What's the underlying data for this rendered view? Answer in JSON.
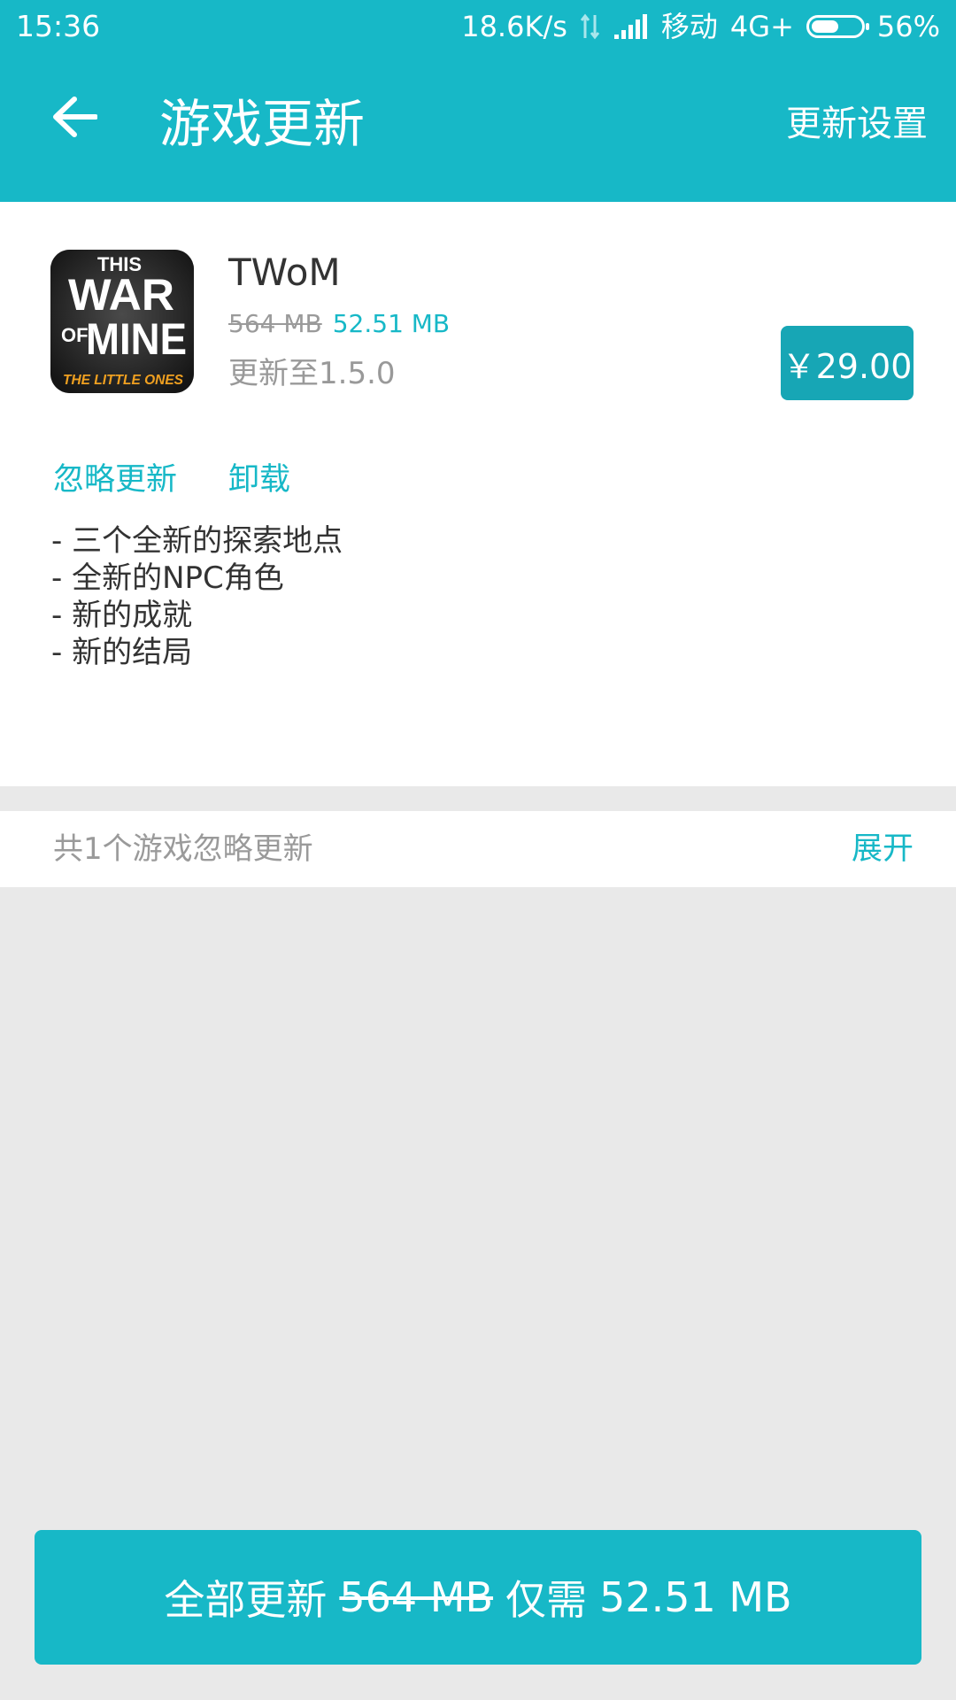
{
  "status_bar": {
    "time": "15:36",
    "network_speed": "18.6K/s",
    "carrier": "移动",
    "network_type": "4G+",
    "battery_percent": "56%",
    "battery_level": 0.56,
    "icons": [
      "data-arrows-icon",
      "signal-icon",
      "battery-icon"
    ]
  },
  "header": {
    "title": "游戏更新",
    "settings_label": "更新设置",
    "back_icon": "back-arrow-icon"
  },
  "game": {
    "name": "TWoM",
    "old_size": "564 MB",
    "new_size": "52.51 MB",
    "version_text": "更新至1.5.0",
    "price": "￥29.00",
    "icon_lines": [
      "THIS",
      "WAR",
      "OF",
      "MINE",
      "THE LITTLE ONES"
    ],
    "actions": {
      "ignore": "忽略更新",
      "uninstall": "卸载"
    },
    "changelog": [
      "- 三个全新的探索地点",
      "- 全新的NPC角色",
      "- 新的成就",
      "- 新的结局"
    ]
  },
  "ignored": {
    "text": "共1个游戏忽略更新",
    "expand_label": "展开"
  },
  "bottom_button": {
    "prefix": "全部更新",
    "old_size": "564 MB",
    "middle": "仅需",
    "new_size": "52.51 MB"
  },
  "colors": {
    "accent": "#17b8c7",
    "price_button": "#17a6b5",
    "background": "#e9e9e9"
  }
}
